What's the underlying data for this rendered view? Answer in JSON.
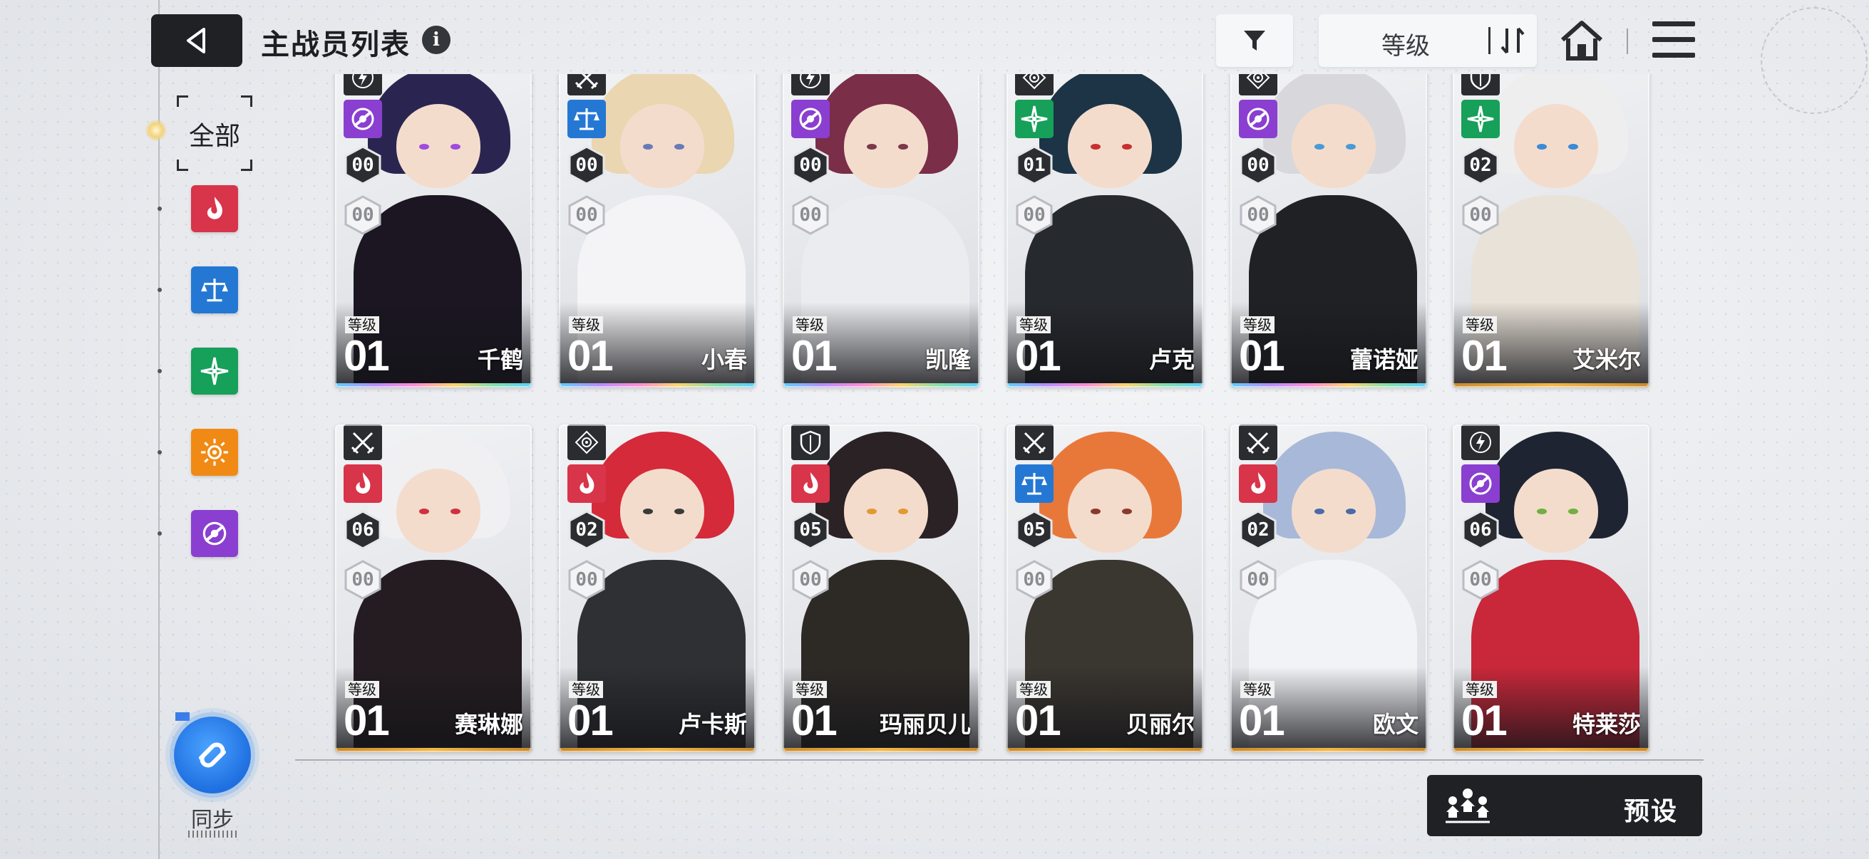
{
  "header": {
    "title": "主战员列表",
    "info_glyph": "i",
    "sort_label": "等级"
  },
  "sidebar": {
    "all_label": "全部",
    "elements": [
      {
        "name": "fire",
        "color": "#d8344a"
      },
      {
        "name": "balance",
        "color": "#2478d4"
      },
      {
        "name": "wind",
        "color": "#16a05a"
      },
      {
        "name": "sun",
        "color": "#f08a14"
      },
      {
        "name": "void",
        "color": "#8a3fd0"
      }
    ],
    "sync_label": "同步"
  },
  "level_tag": "等级",
  "cards": [
    {
      "name": "千鹤",
      "level": "01",
      "rank": "00",
      "sub": "00",
      "class": "lightning",
      "element": "void",
      "rarity": "rainbow",
      "hair": "#2a2550",
      "outfit": "#1b1622",
      "eye": "#a04be0"
    },
    {
      "name": "小春",
      "level": "01",
      "rank": "00",
      "sub": "00",
      "class": "swords",
      "element": "balance",
      "rarity": "rainbow",
      "hair": "#ead6b0",
      "outfit": "#f4f4f6",
      "eye": "#6a7ab8"
    },
    {
      "name": "凯隆",
      "level": "01",
      "rank": "00",
      "sub": "00",
      "class": "lightning",
      "element": "void",
      "rarity": "rainbow",
      "hair": "#7a2e48",
      "outfit": "#ebecef",
      "eye": "#7a3a4a"
    },
    {
      "name": "卢克",
      "level": "01",
      "rank": "01",
      "sub": "00",
      "class": "target",
      "element": "wind",
      "rarity": "rainbow",
      "hair": "#1c3446",
      "outfit": "#26292e",
      "eye": "#c83030"
    },
    {
      "name": "蕾诺娅",
      "level": "01",
      "rank": "00",
      "sub": "00",
      "class": "target",
      "element": "void",
      "rarity": "rainbow",
      "hair": "#d8d8dc",
      "outfit": "#1f2125",
      "eye": "#4a9ad8"
    },
    {
      "name": "艾米尔",
      "level": "01",
      "rank": "02",
      "sub": "00",
      "class": "shield",
      "element": "wind",
      "rarity": "gold",
      "hair": "#eeeeef",
      "outfit": "#e8e2d8",
      "eye": "#3a8ad8"
    },
    {
      "name": "赛琳娜",
      "level": "01",
      "rank": "06",
      "sub": "00",
      "class": "swords",
      "element": "fire",
      "rarity": "gold",
      "hair": "#f0f0f2",
      "outfit": "#241c20",
      "eye": "#d03040"
    },
    {
      "name": "卢卡斯",
      "level": "01",
      "rank": "02",
      "sub": "00",
      "class": "target",
      "element": "fire",
      "rarity": "gold",
      "hair": "#d42a3a",
      "outfit": "#2e3033",
      "eye": "#3a3a3a"
    },
    {
      "name": "玛丽贝儿",
      "level": "01",
      "rank": "05",
      "sub": "00",
      "class": "shield",
      "element": "fire",
      "rarity": "gold",
      "hair": "#2a2224",
      "outfit": "#2d2a26",
      "eye": "#e09a30"
    },
    {
      "name": "贝丽尔",
      "level": "01",
      "rank": "05",
      "sub": "00",
      "class": "swords",
      "element": "balance",
      "rarity": "gold",
      "hair": "#e8783a",
      "outfit": "#3a3630",
      "eye": "#8a3a2a"
    },
    {
      "name": "欧文",
      "level": "01",
      "rank": "02",
      "sub": "00",
      "class": "swords",
      "element": "fire",
      "rarity": "gold",
      "hair": "#a8b8d8",
      "outfit": "#f2f3f6",
      "eye": "#4a6aa8"
    },
    {
      "name": "特莱莎",
      "level": "01",
      "rank": "06",
      "sub": "00",
      "class": "lightning",
      "element": "void",
      "rarity": "gold",
      "hair": "#1e2432",
      "outfit": "#c8283a",
      "eye": "#70b040"
    }
  ],
  "footer": {
    "preset_label": "预设"
  },
  "colors": {
    "fire": "#d8344a",
    "balance": "#2478d4",
    "wind": "#16a05a",
    "sun": "#f08a14",
    "void": "#8a3fd0",
    "dark_button": "#1f2124"
  }
}
